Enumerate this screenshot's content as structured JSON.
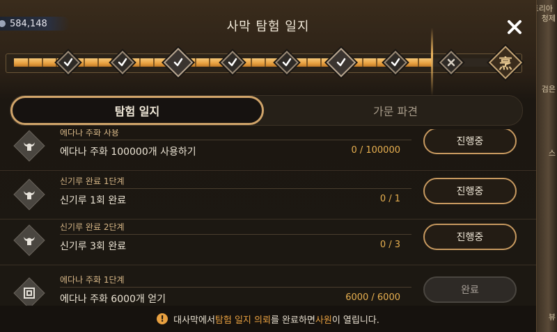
{
  "currency": {
    "amount": "584,148",
    "icon": "silver-coin-icon"
  },
  "background_text": [
    "위스트리아",
    "청제",
    "검은",
    "스",
    "뷰"
  ],
  "title": "사막 탐험 일지",
  "close_icon": "close-icon",
  "progress": {
    "fill_fraction": 0.81,
    "nodes": [
      {
        "state": "complete",
        "size": "small"
      },
      {
        "state": "complete",
        "size": "small"
      },
      {
        "state": "complete",
        "size": "large"
      },
      {
        "state": "complete",
        "size": "small"
      },
      {
        "state": "complete",
        "size": "small"
      },
      {
        "state": "complete",
        "size": "large"
      },
      {
        "state": "complete",
        "size": "small"
      },
      {
        "state": "locked",
        "size": "small"
      },
      {
        "state": "final",
        "size": "large",
        "glyph": "烹"
      }
    ]
  },
  "tabs": [
    {
      "label": "탐험 일지",
      "active": true
    },
    {
      "label": "가문 파견",
      "active": false
    }
  ],
  "quests": [
    {
      "icon": "horned-helmet-icon",
      "category": "에다나 주화 사용",
      "description": "에다나 주화 100000개 사용하기",
      "progress": "0 / 100000",
      "button": "진행중",
      "state": "in-progress"
    },
    {
      "icon": "horned-helmet-icon",
      "category": "신기루 완료 1단계",
      "description": "신기루 1회 완료",
      "progress": "0 / 1",
      "button": "진행중",
      "state": "in-progress"
    },
    {
      "icon": "horned-helmet-icon",
      "category": "신기루 완료 2단계",
      "description": "신기루 3회 완료",
      "progress": "0 / 3",
      "button": "진행중",
      "state": "in-progress"
    },
    {
      "icon": "spiral-coin-icon",
      "category": "에다나 주화 1단계",
      "description": "에다나 주화 6000개 얻기",
      "progress": "6000 / 6000",
      "button": "완료",
      "state": "done"
    }
  ],
  "footer": {
    "icon": "warning-icon",
    "p1": "대사막에서 ",
    "h1": "탐험 일지 의뢰",
    "p2": "를 완료하면 ",
    "h2": "사원",
    "p3": "이 열립니다."
  },
  "colors": {
    "accent": "#e8a040",
    "gold_border": "#c89a60",
    "panel": "#1c1812"
  }
}
